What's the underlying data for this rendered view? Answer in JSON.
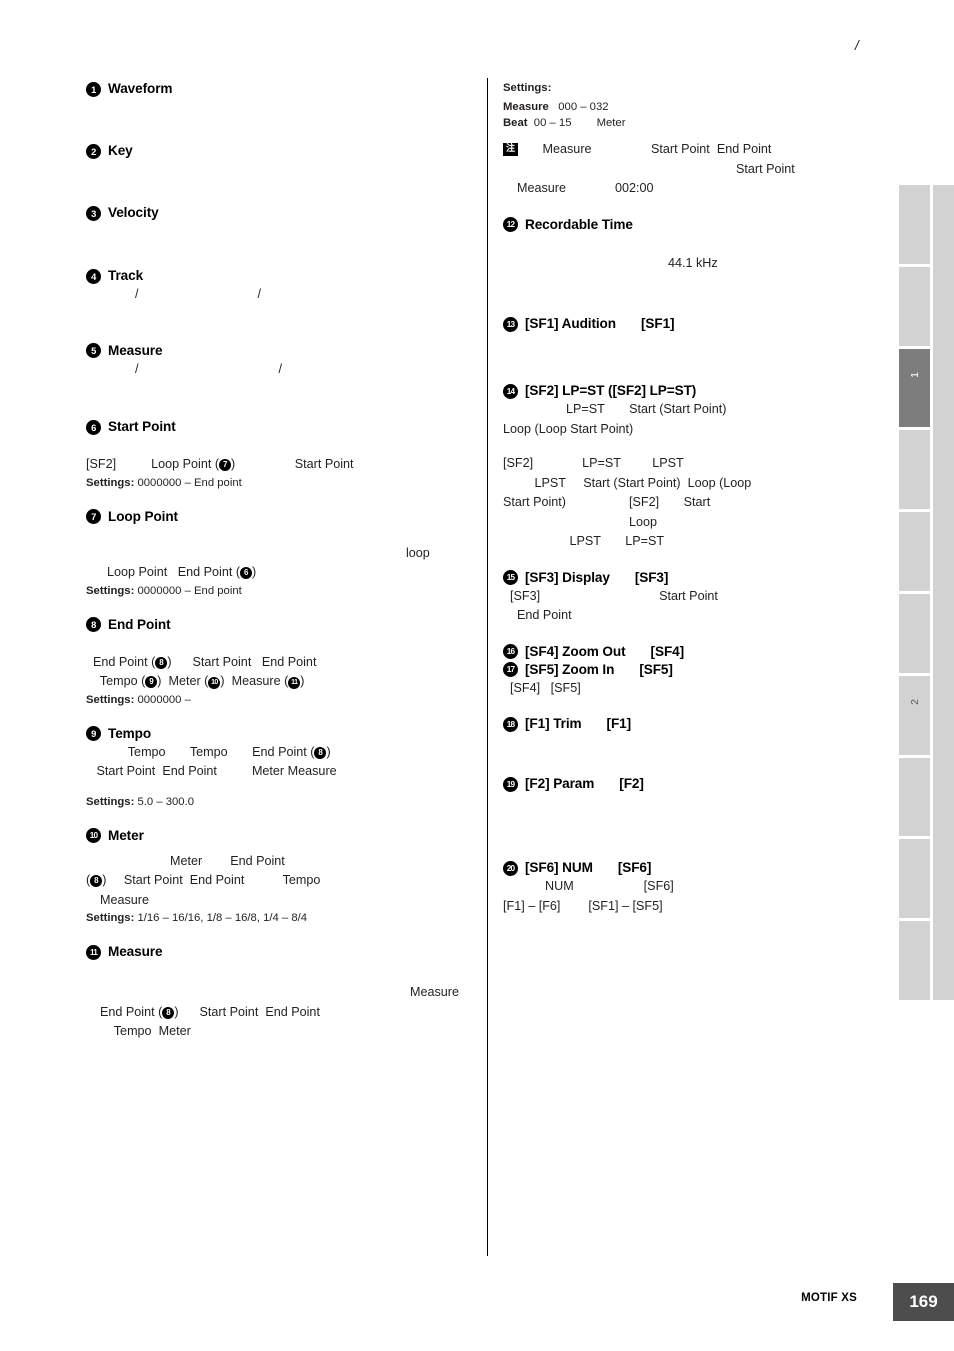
{
  "header": {
    "slash": "/"
  },
  "left_column": [
    {
      "num": "1",
      "title": "Waveform",
      "lines": [],
      "settings": null,
      "gap_after": "xl"
    },
    {
      "num": "2",
      "title": "Key",
      "lines": [],
      "settings": null,
      "gap_after": "xl"
    },
    {
      "num": "3",
      "title": "Velocity",
      "lines": [],
      "settings": null,
      "gap_after": "xl"
    },
    {
      "num": "4",
      "title": "Track",
      "lines": [
        "              /                                  /"
      ],
      "settings": null,
      "gap_after": "lg"
    },
    {
      "num": "5",
      "title": "Measure",
      "lines": [
        "              /                                        /"
      ],
      "settings": null,
      "gap_after": "lg"
    },
    {
      "num": "6",
      "title": "Start Point",
      "lines": [],
      "settings": null,
      "gap_after": "sm"
    }
  ],
  "start_point_block": {
    "line1_a": "[SF2]",
    "line1_b": "Loop Point (",
    "line1_ref": "7",
    "line1_c": ")",
    "line1_d": "Start Point",
    "settings_label": "Settings:",
    "settings_value": "0000000 – End point"
  },
  "loop_point_block": {
    "num": "7",
    "title": "Loop Point",
    "line_loop": "loop",
    "line2_a": "Loop Point",
    "line2_b": "End Point (",
    "line2_ref": "6",
    "line2_c": ")",
    "settings_label": "Settings:",
    "settings_value": "0000000 – End point"
  },
  "end_point_block": {
    "num": "8",
    "title": "End Point",
    "l1_a": "End Point (",
    "l1_ref": "8",
    "l1_b": ")",
    "l1_c": "Start Point",
    "l1_d": "End Point",
    "l2_a": "Tempo (",
    "l2_ref1": "9",
    "l2_b": ")",
    "l2_c": "Meter (",
    "l2_ref2": "10",
    "l2_d": ")",
    "l2_e": "Measure (",
    "l2_ref3": "11",
    "l2_f": ")",
    "settings_label": "Settings:",
    "settings_value": "0000000 –"
  },
  "tempo_block": {
    "num": "9",
    "title": "Tempo",
    "l1_a": "Tempo",
    "l1_b": "Tempo",
    "l1_c": "End Point (",
    "l1_ref": "8",
    "l1_d": ")",
    "l2_a": "Start Point",
    "l2_b": "End Point",
    "l2_c": "Meter",
    "l2_d": "Measure",
    "settings_label": "Settings:",
    "settings_value": "5.0 – 300.0"
  },
  "meter_block": {
    "num": "10",
    "title": "Meter",
    "l1_a": "Meter",
    "l1_b": "End Point",
    "l2_a": "(",
    "l2_ref": "8",
    "l2_b": ")",
    "l2_c": "Start Point",
    "l2_d": "End Point",
    "l2_e": "Tempo",
    "l3": "Measure",
    "settings_label": "Settings:",
    "settings_value": "1/16 – 16/16, 1/8 – 16/8, 1/4 – 8/4"
  },
  "measure_block": {
    "num": "11",
    "title": "Measure",
    "l1": "Measure",
    "l2_a": "End Point (",
    "l2_ref": "8",
    "l2_b": ")",
    "l2_c": "Start Point",
    "l2_d": "End Point",
    "l3_a": "Tempo",
    "l3_b": "Meter"
  },
  "right_column": {
    "settings_header": "Settings:",
    "settings_measure_label": "Measure",
    "settings_measure_value": "000 – 032",
    "settings_beat_label": "Beat",
    "settings_beat_value": "00 – 15",
    "settings_beat_extra": "Meter",
    "note_badge": "注",
    "note_l1_a": "Measure",
    "note_l1_b": "Start Point",
    "note_l1_c": "End Point",
    "note_l2": "Start Point",
    "note_l3_a": "Measure",
    "note_l3_b": "002:00",
    "recordable": {
      "num": "12",
      "title": "Recordable Time",
      "value": "44.1 kHz"
    },
    "sf1_audition": {
      "num": "13",
      "title": "[SF1] Audition",
      "key": "[SF1]"
    },
    "sf2_lpst": {
      "num": "14",
      "title": "[SF2] LP=ST ([SF2] LP=ST)",
      "l1_a": "LP=ST",
      "l1_b": "Start (Start Point)",
      "l2": "Loop (Loop Start Point)",
      "l3_a": "[SF2]",
      "l3_b": "LP=ST",
      "l3_c": "LPST",
      "l4_a": "LPST",
      "l4_b": "Start (Start Point)",
      "l4_c": "Loop (Loop",
      "l5_a": "Start Point)",
      "l5_b": "[SF2]",
      "l5_c": "Start",
      "l6": "Loop",
      "l7_a": "LPST",
      "l7_b": "LP=ST"
    },
    "sf3_display": {
      "num": "15",
      "title": "[SF3] Display",
      "key": "[SF3]",
      "l1_a": "[SF3]",
      "l1_b": "Start Point",
      "l2": "End Point"
    },
    "sf4_zoom_out": {
      "num": "16",
      "title": "[SF4] Zoom Out",
      "key": "[SF4]"
    },
    "sf5_zoom_in": {
      "num": "17",
      "title": "[SF5] Zoom In",
      "key": "[SF5]",
      "l1_a": "[SF4]",
      "l1_b": "[SF5]"
    },
    "f1_trim": {
      "num": "18",
      "title": "[F1] Trim",
      "key": "[F1]"
    },
    "f2_param": {
      "num": "19",
      "title": "[F2] Param",
      "key": "[F2]"
    },
    "sf6_num": {
      "num": "20",
      "title": "[SF6] NUM",
      "key": "[SF6]",
      "l1_a": "NUM",
      "l1_b": "[SF6]",
      "l2_a": "[F1] – [F6]",
      "l2_b": "[SF1] – [SF5]"
    }
  },
  "tabs": [
    {
      "label": "",
      "active": false
    },
    {
      "label": "",
      "active": false
    },
    {
      "label": "1",
      "active": true
    },
    {
      "label": "",
      "active": false
    },
    {
      "label": "",
      "active": false
    },
    {
      "label": "",
      "active": false
    },
    {
      "label": "2",
      "active": false
    },
    {
      "label": "",
      "active": false
    },
    {
      "label": "",
      "active": false
    },
    {
      "label": "",
      "active": false
    }
  ],
  "footer": {
    "product": "MOTIF XS",
    "page_number": "169"
  }
}
